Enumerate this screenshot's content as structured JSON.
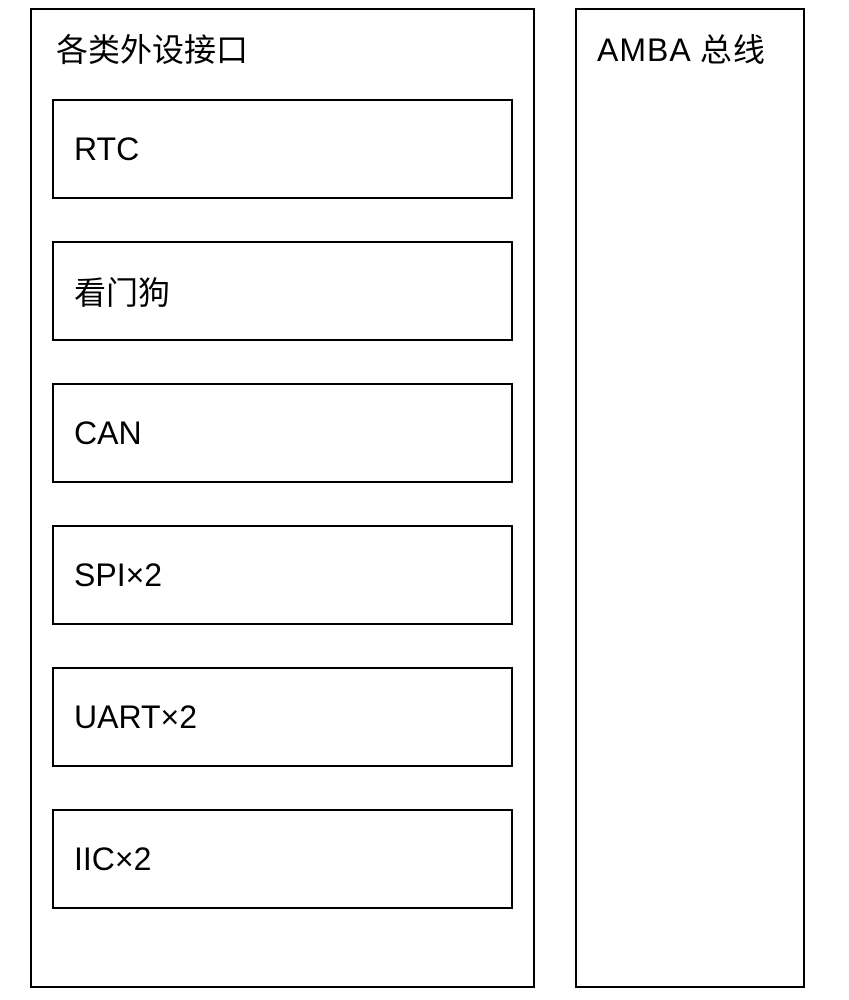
{
  "left": {
    "title": "各类外设接口",
    "items": [
      {
        "label": "RTC"
      },
      {
        "label": "看门狗"
      },
      {
        "label": "CAN"
      },
      {
        "label": "SPI×2"
      },
      {
        "label": "UART×2"
      },
      {
        "label": "IIC×2"
      }
    ]
  },
  "right": {
    "title": "AMBA 总线"
  }
}
